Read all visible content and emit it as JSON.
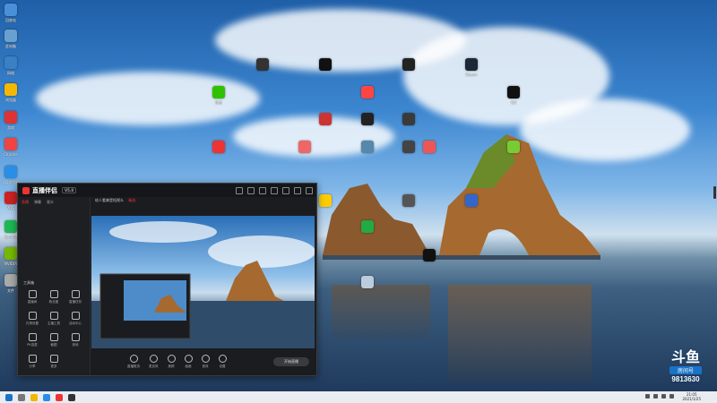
{
  "colors": {
    "accent": "#e33333",
    "taskbar": "#e9edf2",
    "window_bg": "#1b1c20"
  },
  "desktop_icons_left": [
    {
      "name": "recycle-bin-icon",
      "label": "回收站",
      "color": "#4a90d9"
    },
    {
      "name": "computer-icon",
      "label": "此电脑",
      "color": "#6aa0d0"
    },
    {
      "name": "network-icon",
      "label": "网络",
      "color": "#3b7fc4"
    },
    {
      "name": "browser-icon",
      "label": "浏览器",
      "color": "#f5b800"
    },
    {
      "name": "game-icon",
      "label": "游戏",
      "color": "#d33"
    },
    {
      "name": "chrome-icon",
      "label": "Chrome",
      "color": "#e44"
    },
    {
      "name": "qq-browser-icon",
      "label": "QQ浏览器",
      "color": "#2a8de6"
    },
    {
      "name": "wps-icon",
      "label": "WPS",
      "color": "#c22"
    },
    {
      "name": "spotify-icon",
      "label": "Spotify",
      "color": "#1db954"
    },
    {
      "name": "nvidia-icon",
      "label": "NVIDIA",
      "color": "#76b900"
    },
    {
      "name": "file-icon",
      "label": "文件",
      "color": "#aaa"
    }
  ],
  "desktop_icons_scattered": [
    {
      "name": "app-icon-1",
      "label": "",
      "color": "#333"
    },
    {
      "name": "app-icon-2",
      "label": "",
      "color": "#111"
    },
    {
      "name": "app-icon-3",
      "label": "",
      "color": "#222"
    },
    {
      "name": "steam-icon",
      "label": "Steam",
      "color": "#1b2838"
    },
    {
      "name": "wechat-icon",
      "label": "微信",
      "color": "#2dc100"
    },
    {
      "name": "app-icon-4",
      "label": "",
      "color": "#f44"
    },
    {
      "name": "qq-icon",
      "label": "QQ",
      "color": "#111"
    },
    {
      "name": "app-icon-5",
      "label": "",
      "color": "#c33"
    },
    {
      "name": "app-icon-6",
      "label": "",
      "color": "#222"
    },
    {
      "name": "app-icon-7",
      "label": "",
      "color": "#3a3a3a"
    },
    {
      "name": "netease-music-icon",
      "label": "",
      "color": "#e33"
    },
    {
      "name": "app-icon-8",
      "label": "",
      "color": "#e66"
    },
    {
      "name": "app-icon-9",
      "label": "",
      "color": "#58a"
    },
    {
      "name": "app-icon-10",
      "label": "",
      "color": "#444"
    },
    {
      "name": "app-icon-11",
      "label": "",
      "color": "#e55"
    },
    {
      "name": "app-icon-12",
      "label": "",
      "color": "#7c3"
    },
    {
      "name": "app-icon-13",
      "label": "",
      "color": "#fc0"
    },
    {
      "name": "app-icon-14",
      "label": "",
      "color": "#555"
    },
    {
      "name": "app-icon-15",
      "label": "",
      "color": "#36c"
    },
    {
      "name": "app-icon-16",
      "label": "",
      "color": "#2a4"
    },
    {
      "name": "app-icon-17",
      "label": "",
      "color": "#111"
    },
    {
      "name": "app-icon-18",
      "label": "",
      "color": "#bcd"
    }
  ],
  "app_window": {
    "logo_text": "直播伴侣",
    "version": "V5.0",
    "left_tabs": [
      "直播",
      "弹幕",
      "观众"
    ],
    "room_title": "给人看拿是短视么",
    "room_tag": "精选",
    "tools_title": "工具箱",
    "tools": [
      "直播间",
      "粉丝团",
      "直播任务",
      "礼物设置",
      "主播工具",
      "活动中心",
      "PK连麦",
      "截图",
      "其他",
      "分享",
      "更多"
    ],
    "bottom_tools": [
      "直播推流",
      "麦克风",
      "美颜",
      "画面",
      "音效",
      "设置"
    ],
    "live_button": "开始直播"
  },
  "taskbar": {
    "time": "21:05",
    "date": "2021/1/25"
  },
  "watermark": {
    "brand": "斗鱼",
    "sub": "房间号",
    "room": "9813630"
  }
}
